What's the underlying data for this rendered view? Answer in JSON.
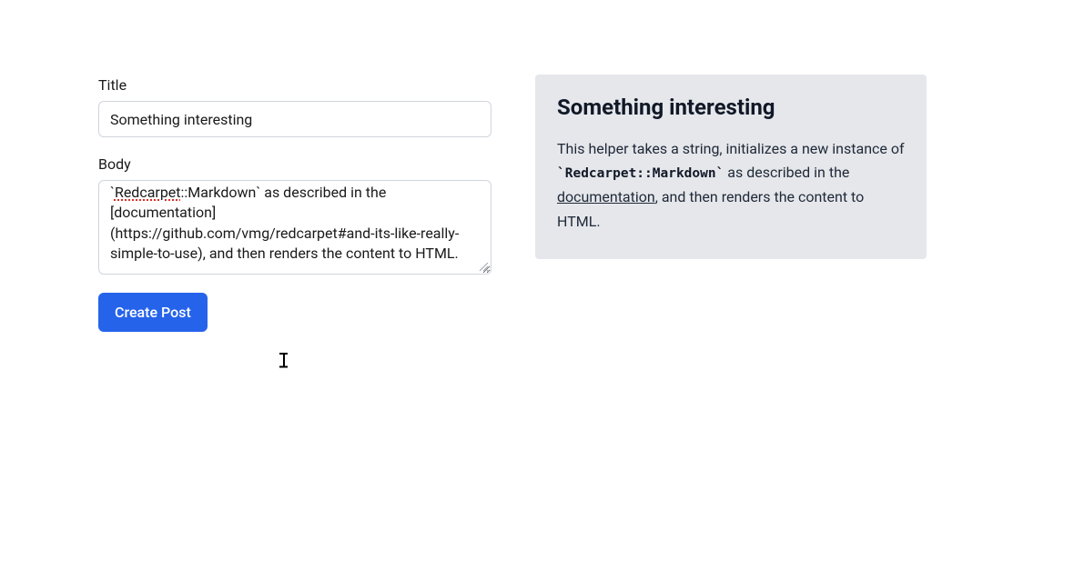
{
  "form": {
    "title_label": "Title",
    "title_value": "Something interesting",
    "body_label": "Body",
    "body_value": "`Redcarpet::Markdown` as described in the [documentation](https://github.com/vmg/redcarpet#and-its-like-really-simple-to-use), and then renders the content to HTML.",
    "body_segments": {
      "tick1": "`",
      "spelled": "Redcarpet",
      "rest": "::Markdown` as described in the [documentation](https://github.com/vmg/redcarpet#and-its-like-really-simple-to-use), and then renders the content to HTML."
    },
    "submit_label": "Create Post"
  },
  "preview": {
    "title": "Something interesting",
    "body_pre": "This helper takes a string, initializes a new instance of ",
    "body_code": "`Redcarpet::Markdown`",
    "body_mid": " as described in the ",
    "body_link_text": "documentation",
    "body_post": ", and then renders the content to HTML."
  }
}
